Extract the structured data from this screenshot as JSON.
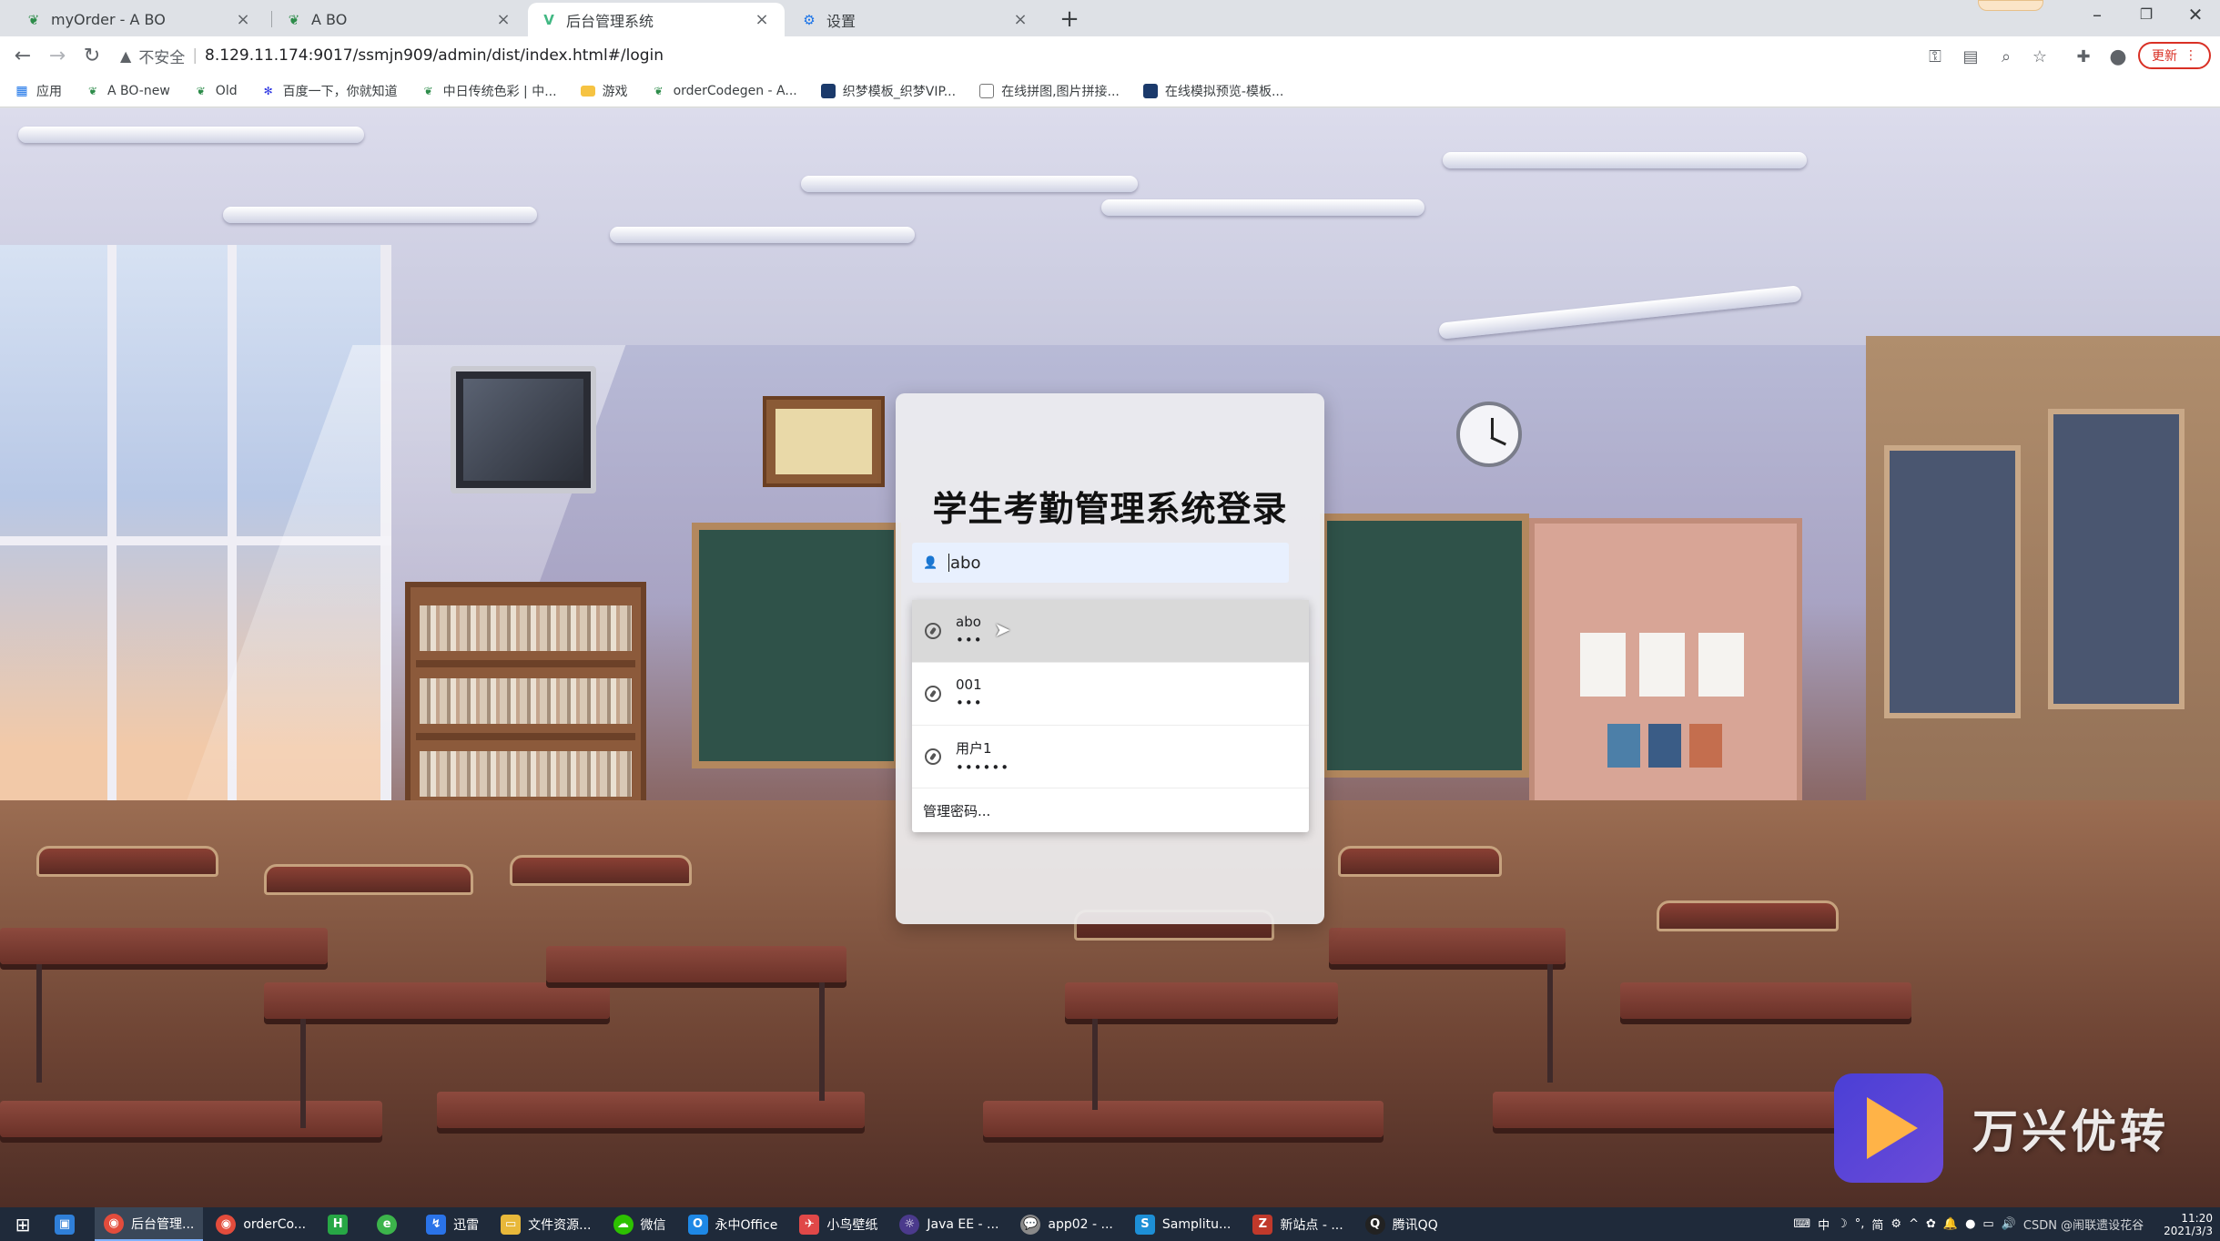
{
  "browser": {
    "tabs": [
      {
        "title": "myOrder - A BO",
        "icon": "leaf-icon",
        "active": false
      },
      {
        "title": "A BO",
        "icon": "leaf-icon",
        "active": false
      },
      {
        "title": "后台管理系统",
        "icon": "vue-icon",
        "active": true
      },
      {
        "title": "设置",
        "icon": "gear-icon",
        "active": false
      }
    ],
    "new_tab_label": "+",
    "omnibox": {
      "security_label": "不安全",
      "url": "8.129.11.174:9017/ssmjn909/admin/dist/index.html#/login"
    },
    "update_label": "更新",
    "bookmarks": [
      {
        "label": "应用",
        "icon": "apps-grid-icon"
      },
      {
        "label": "A BO-new",
        "icon": "leaf-icon"
      },
      {
        "label": "Old",
        "icon": "leaf-icon"
      },
      {
        "label": "百度一下，你就知道",
        "icon": "baidu-paw-icon"
      },
      {
        "label": "中日传统色彩 | 中...",
        "icon": "leaf-icon"
      },
      {
        "label": "游戏",
        "icon": "folder-icon"
      },
      {
        "label": "orderCodegen - A...",
        "icon": "leaf-icon"
      },
      {
        "label": "织梦模板_织梦VIP...",
        "icon": "square-logo-icon"
      },
      {
        "label": "在线拼图,图片拼接...",
        "icon": "image-icon"
      },
      {
        "label": "在线模拟预览-模板...",
        "icon": "square-logo-icon"
      }
    ]
  },
  "login": {
    "title": "学生考勤管理系统登录",
    "username_value": "abo",
    "autocomplete": [
      {
        "name": "abo",
        "password_mask": "•••"
      },
      {
        "name": "001",
        "password_mask": "•••"
      },
      {
        "name": "用户1",
        "password_mask": "••••••"
      }
    ],
    "manage_passwords_label": "管理密码..."
  },
  "watermark": {
    "text": "万兴优转"
  },
  "taskbar": {
    "items": [
      {
        "label": "",
        "icon": "store-icon",
        "color": "#2f7fd8"
      },
      {
        "label": "后台管理...",
        "icon": "chrome-icon",
        "color": "#e34c3c",
        "active": true
      },
      {
        "label": "orderCo...",
        "icon": "chrome-icon",
        "color": "#e34c3c"
      },
      {
        "label": "",
        "icon": "hbuilder-icon",
        "color": "#27a745"
      },
      {
        "label": "",
        "icon": "360-icon",
        "color": "#3cb44b"
      },
      {
        "label": "迅雷",
        "icon": "xunlei-icon",
        "color": "#2a73e8"
      },
      {
        "label": "文件资源...",
        "icon": "folder-icon",
        "color": "#e8b83a"
      },
      {
        "label": "微信",
        "icon": "wechat-icon",
        "color": "#2dc100"
      },
      {
        "label": "永中Office",
        "icon": "office-icon",
        "color": "#1e88e5"
      },
      {
        "label": "小鸟壁纸",
        "icon": "bird-icon",
        "color": "#e04848"
      },
      {
        "label": "Java EE - ...",
        "icon": "eclipse-icon",
        "color": "#4b3a8c"
      },
      {
        "label": "app02 - ...",
        "icon": "chat-icon",
        "color": "#8a8a8a"
      },
      {
        "label": "Samplitu...",
        "icon": "samplitude-icon",
        "color": "#1d8fd6"
      },
      {
        "label": "新站点 - ...",
        "icon": "filezilla-icon",
        "color": "#c0392b"
      },
      {
        "label": "腾讯QQ",
        "icon": "qq-icon",
        "color": "#222"
      }
    ],
    "tray": {
      "ime": "中",
      "ime2": "简",
      "csdn_text": "CSDN @闹联遗设花谷",
      "date": "2021/3/3",
      "time": "11:20"
    }
  }
}
